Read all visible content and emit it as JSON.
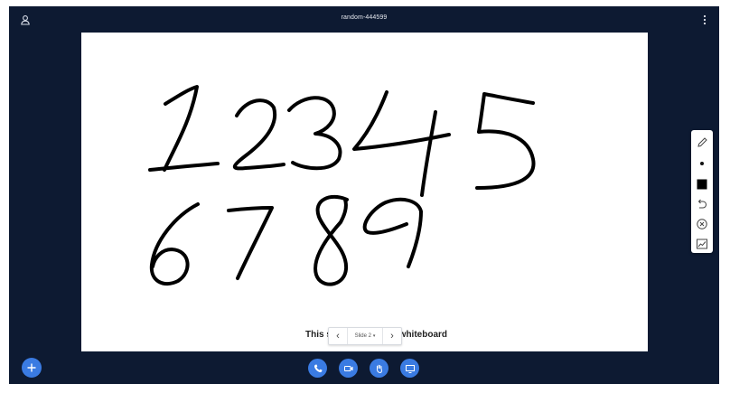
{
  "header": {
    "session_title": "random-444599",
    "icons": [
      "user-icon",
      "more-vertical-icon"
    ]
  },
  "presentation": {
    "caption_start": "This s",
    "caption_end": "r whiteboard",
    "slide_selector": "Slide 2",
    "prev_glyph": "‹",
    "next_glyph": "›",
    "caret": "▾"
  },
  "whiteboard_toolbar": {
    "tools": [
      "pencil-icon",
      "thickness-dot-icon",
      "color-swatch-icon",
      "undo-icon",
      "clear-icon",
      "multi-user-icon"
    ],
    "selected_color": "#000000"
  },
  "bottom_actions": {
    "icons": [
      "add-icon",
      "phone-icon",
      "video-camera-icon",
      "raise-hand-icon",
      "screen-share-icon"
    ]
  },
  "colors": {
    "app_background": "#0d1a32",
    "accent": "#3a7be2",
    "slide": "#ffffff"
  }
}
